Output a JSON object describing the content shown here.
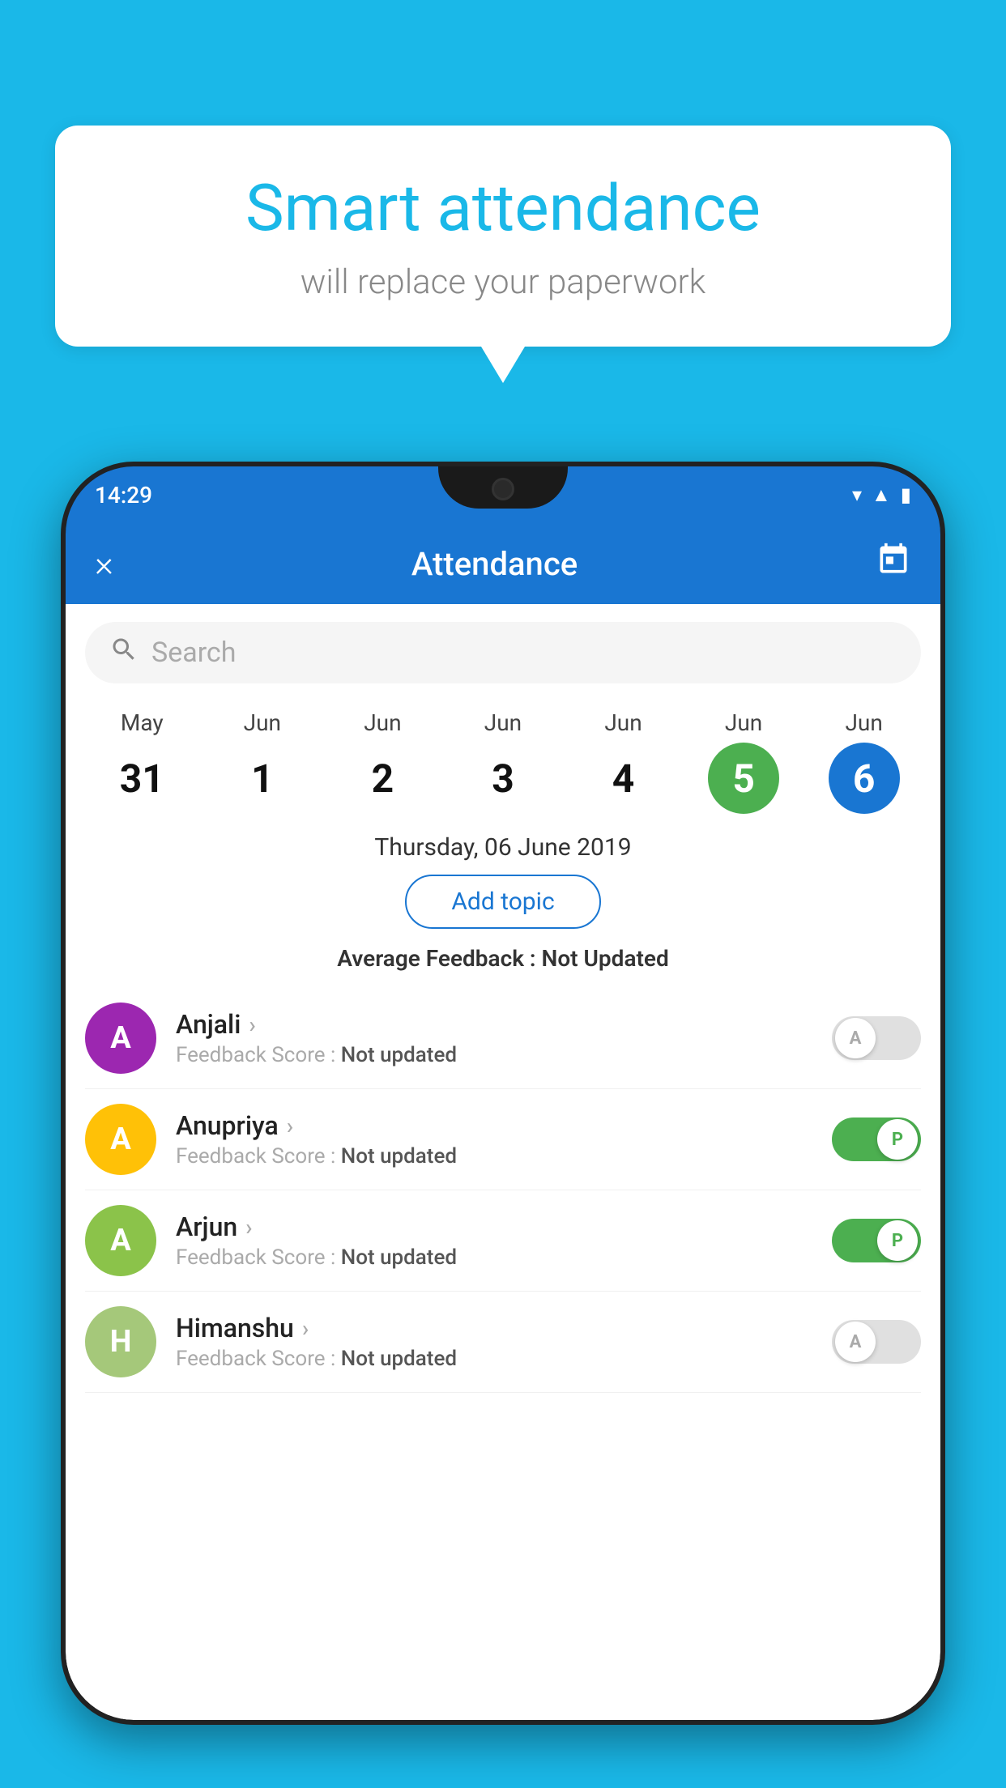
{
  "background_color": "#1ab8e8",
  "bubble": {
    "title": "Smart attendance",
    "subtitle": "will replace your paperwork"
  },
  "status_bar": {
    "time": "14:29",
    "icons": [
      "wifi",
      "signal",
      "battery"
    ]
  },
  "app_bar": {
    "close_label": "×",
    "title": "Attendance",
    "calendar_icon": "📅"
  },
  "search": {
    "placeholder": "Search"
  },
  "calendar": {
    "days": [
      {
        "month": "May",
        "date": "31",
        "state": "normal"
      },
      {
        "month": "Jun",
        "date": "1",
        "state": "normal"
      },
      {
        "month": "Jun",
        "date": "2",
        "state": "normal"
      },
      {
        "month": "Jun",
        "date": "3",
        "state": "normal"
      },
      {
        "month": "Jun",
        "date": "4",
        "state": "normal"
      },
      {
        "month": "Jun",
        "date": "5",
        "state": "today"
      },
      {
        "month": "Jun",
        "date": "6",
        "state": "selected"
      }
    ]
  },
  "selected_date_label": "Thursday, 06 June 2019",
  "add_topic_label": "Add topic",
  "avg_feedback_label": "Average Feedback :",
  "avg_feedback_value": "Not Updated",
  "students": [
    {
      "name": "Anjali",
      "avatar_letter": "A",
      "avatar_color": "#9c27b0",
      "feedback_label": "Feedback Score :",
      "feedback_value": "Not updated",
      "attendance": "absent"
    },
    {
      "name": "Anupriya",
      "avatar_letter": "A",
      "avatar_color": "#ffc107",
      "feedback_label": "Feedback Score :",
      "feedback_value": "Not updated",
      "attendance": "present"
    },
    {
      "name": "Arjun",
      "avatar_letter": "A",
      "avatar_color": "#8bc34a",
      "feedback_label": "Feedback Score :",
      "feedback_value": "Not updated",
      "attendance": "present"
    },
    {
      "name": "Himanshu",
      "avatar_letter": "H",
      "avatar_color": "#a5c87a",
      "feedback_label": "Feedback Score :",
      "feedback_value": "Not updated",
      "attendance": "absent"
    }
  ]
}
